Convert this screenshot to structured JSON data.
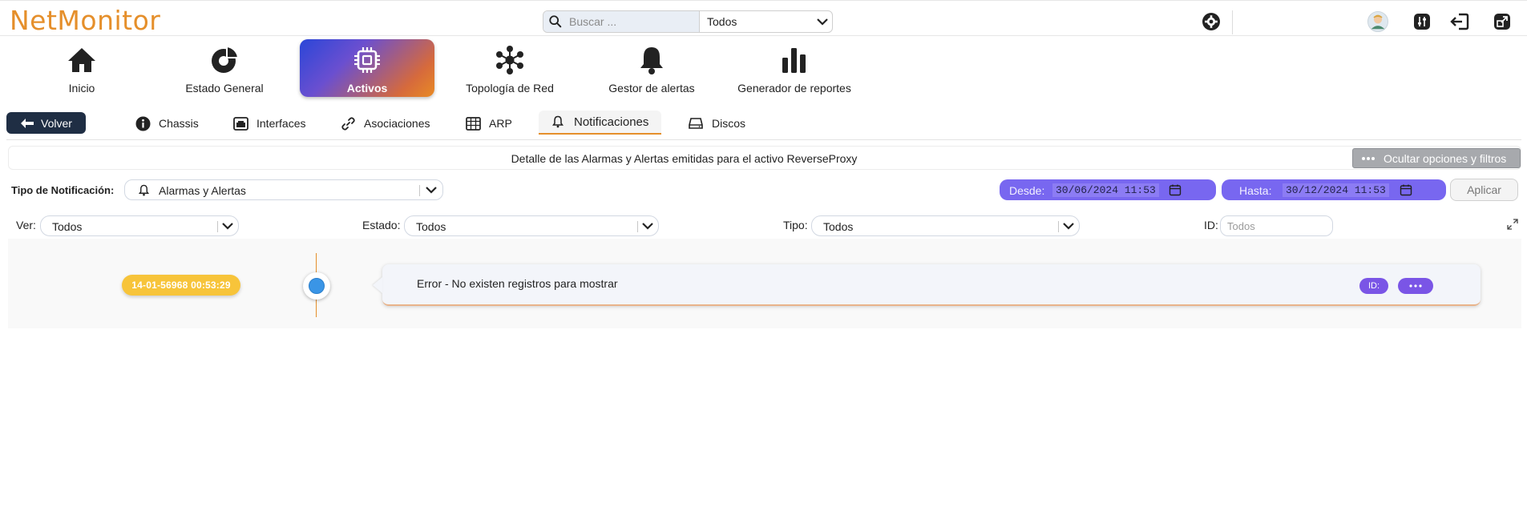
{
  "app": {
    "title": "NetMonitor"
  },
  "search": {
    "placeholder": "Buscar ...",
    "scope": "Todos"
  },
  "main_nav": {
    "items": [
      {
        "label": "Inicio",
        "icon": "home-icon"
      },
      {
        "label": "Estado General",
        "icon": "pie-chart-icon"
      },
      {
        "label": "Activos",
        "icon": "cpu-chip-icon",
        "active": true
      },
      {
        "label": "Topología de Red",
        "icon": "network-topology-icon"
      },
      {
        "label": "Gestor de alertas",
        "icon": "bell-icon"
      },
      {
        "label": "Generador de reportes",
        "icon": "bar-chart-icon"
      }
    ]
  },
  "sub_nav": {
    "back_label": "Volver",
    "tabs": [
      {
        "label": "Chassis",
        "icon": "info-icon"
      },
      {
        "label": "Interfaces",
        "icon": "ethernet-port-icon"
      },
      {
        "label": "Asociaciones",
        "icon": "link-icon"
      },
      {
        "label": "ARP",
        "icon": "table-icon"
      },
      {
        "label": "Notificaciones",
        "icon": "bell-icon",
        "active": true
      },
      {
        "label": "Discos",
        "icon": "hard-disk-icon"
      }
    ]
  },
  "detail": {
    "title": "Detalle de las Alarmas y Alertas emitidas para el activo ReverseProxy",
    "options_label": "Ocultar opciones y filtros"
  },
  "filters": {
    "tipo_notificacion_label": "Tipo de Notificación:",
    "tipo_notificacion_value": "Alarmas y Alertas",
    "desde_label": "Desde:",
    "desde_value": "30/06/2024 11:53",
    "hasta_label": "Hasta:",
    "hasta_value": "30/12/2024 11:53",
    "apply_label": "Aplicar",
    "ver_label": "Ver:",
    "ver_value": "Todos",
    "estado_label": "Estado:",
    "estado_value": "Todos",
    "tipo_label": "Tipo:",
    "tipo_value": "Todos",
    "id_label": "ID:",
    "id_placeholder": "Todos"
  },
  "timeline": {
    "entries": [
      {
        "timestamp": "14-01-56968 00:53:29",
        "message": "Error - No existen registros para mostrar",
        "id_badge": "ID:"
      }
    ]
  },
  "colors": {
    "brand": "#e58f2b",
    "navy": "#1f2e44",
    "date_pill": "#7867f0",
    "badge_purple": "#7a55e6",
    "timestamp_badge": "#f7c43a",
    "timeline_dot": "#3a95e6"
  }
}
